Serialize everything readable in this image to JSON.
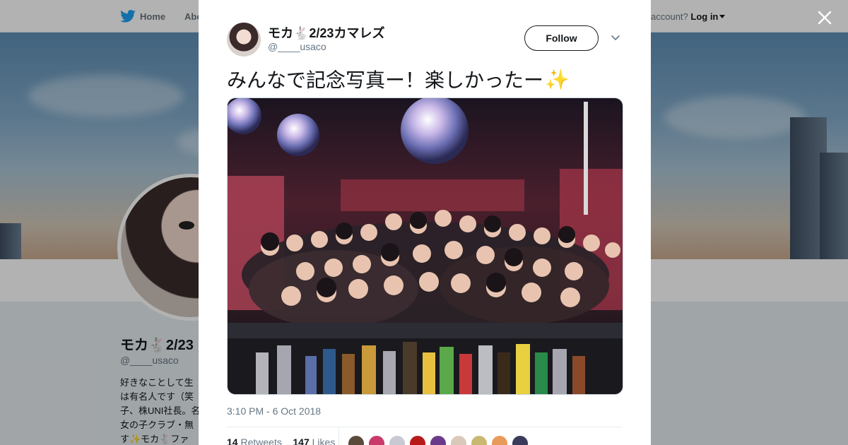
{
  "topbar": {
    "home_label": "Home",
    "about_label": "Abo",
    "account_prefix": "account?",
    "login_label": "Log in"
  },
  "profile": {
    "name": "モカ🐇2/23",
    "handle": "@____usaco",
    "bio": "好きなことして生\nは有名人です（笑\n子、株UNI社長。名\n女の子クラブ・無\nす✨モカ🐇ファ"
  },
  "tweet": {
    "author_name": "モカ🐇2/23カマレズ",
    "author_handle": "@____usaco",
    "follow_label": "Follow",
    "text": "みんなで記念写真ー！楽しかったー",
    "text_emoji": "✨",
    "timestamp": "3:10 PM - 6 Oct 2018",
    "retweets_count": "14",
    "retweets_label": "Retweets",
    "likes_count": "147",
    "likes_label": "Likes"
  },
  "colors": {
    "twitter_blue": "#1da1f2",
    "text_dark": "#14171a",
    "text_muted": "#657786"
  },
  "icons": {
    "brand": "twitter-bird-icon",
    "close": "close-icon",
    "more": "chevron-down-icon"
  }
}
